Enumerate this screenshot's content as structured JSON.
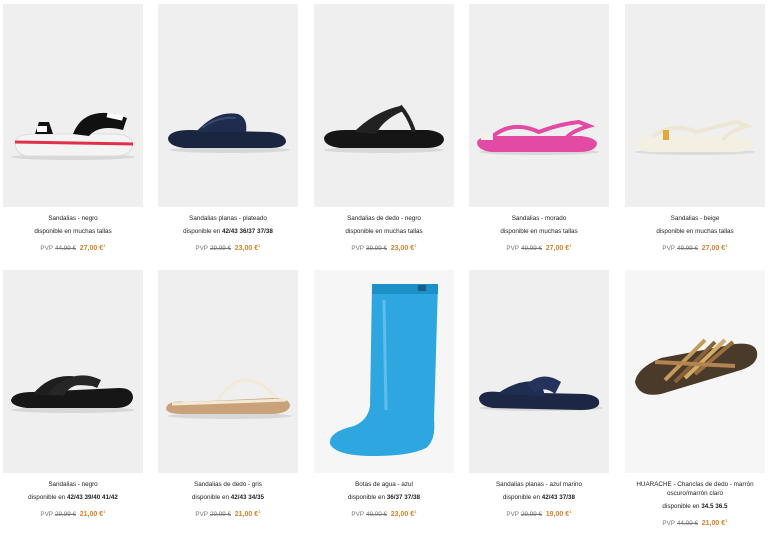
{
  "products": [
    {
      "name": "Sandalias - negro",
      "sizes_prefix": "disponible en muchas tallas",
      "sizes": "",
      "pvp": "PVP",
      "old_price": "44,99 €",
      "new_price": "27,00 €",
      "note": "1",
      "image": "black-pink-sport-sandal"
    },
    {
      "name": "Sandalias planas - plateado",
      "sizes_prefix": "disponible en",
      "sizes": "42/43 36/37 37/38",
      "pvp": "PVP",
      "old_price": "29,99 €",
      "new_price": "23,00 €",
      "note": "1",
      "image": "navy-flat-sandal"
    },
    {
      "name": "Sandalias de dedo - negro",
      "sizes_prefix": "disponible en muchas tallas",
      "sizes": "",
      "pvp": "PVP",
      "old_price": "39,99 €",
      "new_price": "23,00 €",
      "note": "1",
      "image": "black-thong-sandal"
    },
    {
      "name": "Sandalias - morado",
      "sizes_prefix": "disponible en muchas tallas",
      "sizes": "",
      "pvp": "PVP",
      "old_price": "49,99 €",
      "new_price": "27,00 €",
      "note": "1",
      "image": "pink-strap-sandal"
    },
    {
      "name": "Sandalias - beige",
      "sizes_prefix": "disponible en muchas tallas",
      "sizes": "",
      "pvp": "PVP",
      "old_price": "49,99 €",
      "new_price": "27,00 €",
      "note": "1",
      "image": "beige-strap-sandal"
    },
    {
      "name": "Sandalias - negro",
      "sizes_prefix": "disponible en",
      "sizes": "42/43 39/40 41/42",
      "pvp": "PVP",
      "old_price": "29,99 €",
      "new_price": "21,00 €",
      "note": "1",
      "image": "black-wedge-slide"
    },
    {
      "name": "Sandalias de dedo - gris",
      "sizes_prefix": "disponible en",
      "sizes": "42/43 34/35",
      "pvp": "PVP",
      "old_price": "29,99 €",
      "new_price": "21,00 €",
      "note": "1",
      "image": "cream-thong-sandal"
    },
    {
      "name": "Botas de agua - azul",
      "sizes_prefix": "disponible en",
      "sizes": "36/37 37/38",
      "pvp": "PVP",
      "old_price": "49,00 €",
      "new_price": "23,00 €",
      "note": "1",
      "image": "blue-rain-boot"
    },
    {
      "name": "Sandalias planas - azul marino",
      "sizes_prefix": "disponible en",
      "sizes": "42/43 37/38",
      "pvp": "PVP",
      "old_price": "29,99 €",
      "new_price": "19,00 €",
      "note": "1",
      "image": "navy-slide"
    },
    {
      "name": "HUARACHE - Chanclas de dedo - marrón oscuro/marrón claro",
      "sizes_prefix": "disponible en",
      "sizes": "34.5 36.5",
      "pvp": "PVP",
      "old_price": "44,00 €",
      "new_price": "21,00 €",
      "note": "1",
      "image": "brown-huarache-sandal"
    }
  ]
}
